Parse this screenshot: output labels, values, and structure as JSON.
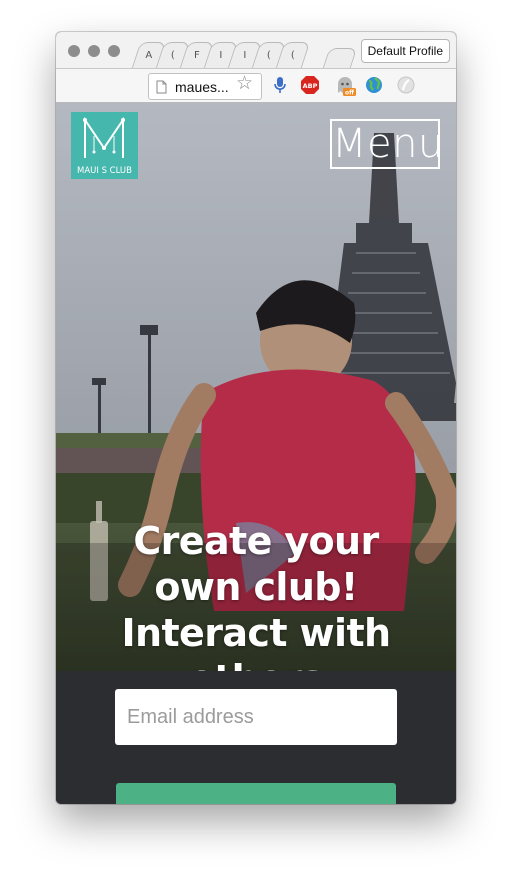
{
  "browser": {
    "tabs": [
      "A",
      "(",
      "F",
      "I",
      "I",
      "(",
      "("
    ],
    "profile_label": "Default Profile",
    "url": "maues...",
    "icons": [
      "document-icon",
      "star-icon",
      "microphone-icon",
      "adblock-icon",
      "ghostery-icon",
      "globe-icon",
      "extension-icon"
    ],
    "adblock_text": "ABP",
    "ghostery_badge": "off"
  },
  "site": {
    "logo_text": "MAUI S CLUB",
    "logo_letter": "M",
    "menu_label": "Menu",
    "headline": "Create your own club! Interact with others",
    "email_placeholder": "Email address",
    "colors": {
      "logo_bg": "#45b7ad",
      "form_bg": "#2c2d31",
      "button_bg": "#4cb285",
      "shirt": "#c92e4d"
    }
  }
}
